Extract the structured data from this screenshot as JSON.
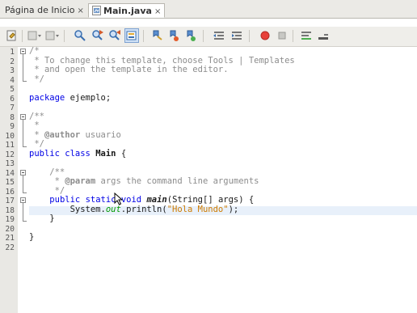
{
  "tabs": [
    {
      "label": "Página de Inicio",
      "close": "×",
      "active": false
    },
    {
      "label": "Main.java",
      "close": "×",
      "active": true
    }
  ],
  "toolbar_icons": [
    "last-edit-icon",
    "back-dropdown-icon",
    "forward-dropdown-icon",
    "find-selection-icon",
    "find-previous-icon",
    "find-next-icon",
    "toggle-highlight-icon",
    "toggle-bookmark-icon",
    "previous-bookmark-icon",
    "next-bookmark-icon",
    "shift-left-icon",
    "shift-right-icon",
    "start-macro-icon",
    "stop-macro-icon",
    "comment-icon",
    "uncomment-icon"
  ],
  "editor": {
    "line_numbers": [
      "1",
      "2",
      "3",
      "4",
      "5",
      "6",
      "7",
      "8",
      "9",
      "10",
      "11",
      "12",
      "13",
      "14",
      "15",
      "16",
      "17",
      "18",
      "19",
      "20",
      "21",
      "22"
    ],
    "highlighted_line": 18,
    "lines": {
      "l1": "/*",
      "l2": " * To change this template, choose Tools | Templates",
      "l3": " * and open the template in the editor.",
      "l4": " */",
      "l6_kw": "package",
      "l6_rest": " ejemplo;",
      "l8": "/**",
      "l9": " *",
      "l10_pre": " * ",
      "l10_tag": "@author",
      "l10_rest": " usuario",
      "l11": " */",
      "l12_kw1": "public",
      "l12_kw2": "class",
      "l12_name": "Main",
      "l12_rest": " {",
      "l14": "    /**",
      "l15_pre": "     * ",
      "l15_tag": "@param",
      "l15_rest": " args the command line arguments",
      "l16": "     */",
      "l17_kw1": "public",
      "l17_kw2": "static",
      "l17_kw3": "void",
      "l17_name": "main",
      "l17_rest": "(String[] args) {",
      "l18_pre": "        System.",
      "l18_out": "out",
      "l18_mid": ".println(",
      "l18_str": "\"Hola Mundo\"",
      "l18_end": ");",
      "l19": "    }",
      "l21": "}"
    }
  },
  "colors": {
    "keyword": "#0000e6",
    "comment": "#8c8c8c",
    "string": "#ce7b00",
    "field": "#009900",
    "line_highlight": "#e8f0fa"
  }
}
